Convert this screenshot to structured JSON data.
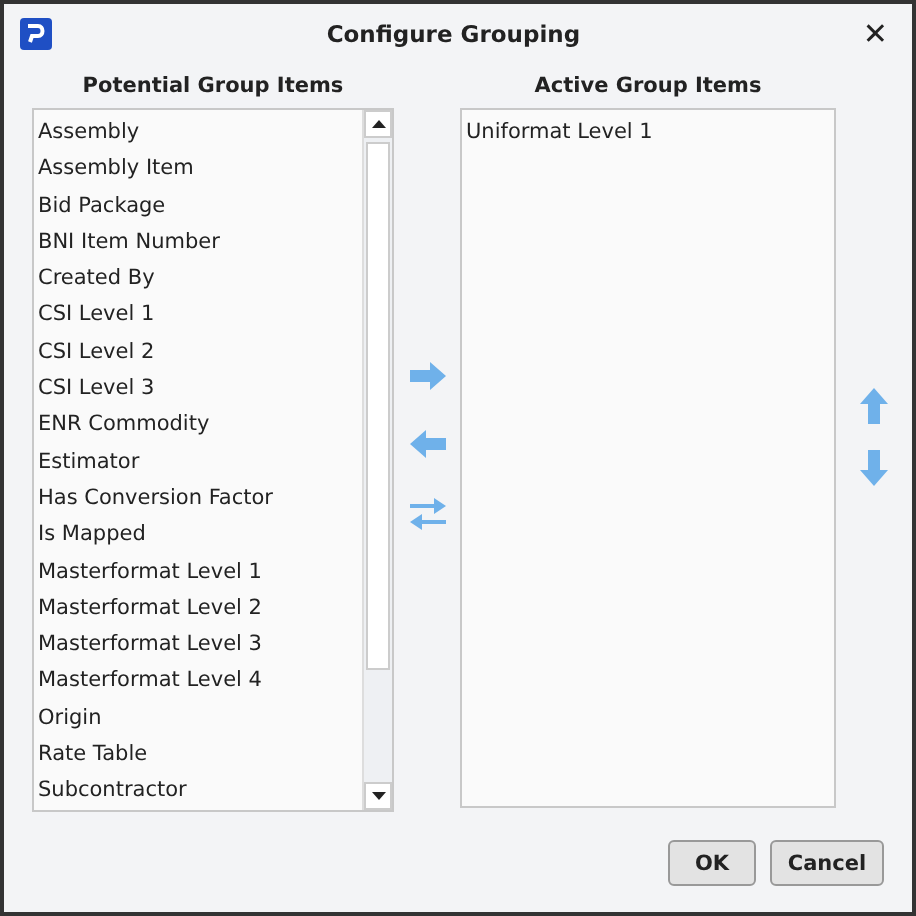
{
  "window": {
    "title": "Configure Grouping",
    "close": "✕"
  },
  "potential": {
    "heading": "Potential Group Items",
    "items": [
      {
        "label": "Assembly"
      },
      {
        "label": "Assembly Item"
      },
      {
        "label": "Bid Package"
      },
      {
        "label": "BNI Item Number"
      },
      {
        "label": "Created By"
      },
      {
        "label": "CSI Level 1"
      },
      {
        "label": "CSI Level 2"
      },
      {
        "label": "CSI Level 3"
      },
      {
        "label": "ENR Commodity"
      },
      {
        "label": "Estimator"
      },
      {
        "label": "Has Conversion Factor"
      },
      {
        "label": "Is Mapped"
      },
      {
        "label": "Masterformat Level 1"
      },
      {
        "label": "Masterformat Level 2"
      },
      {
        "label": "Masterformat Level 3"
      },
      {
        "label": "Masterformat Level 4"
      },
      {
        "label": "Origin"
      },
      {
        "label": "Rate Table"
      },
      {
        "label": "Subcontractor"
      }
    ]
  },
  "active": {
    "heading": "Active Group Items",
    "items": [
      {
        "label": "Uniformat Level 1"
      }
    ]
  },
  "buttons": [
    {
      "label": "OK"
    },
    {
      "label": "Cancel"
    }
  ]
}
